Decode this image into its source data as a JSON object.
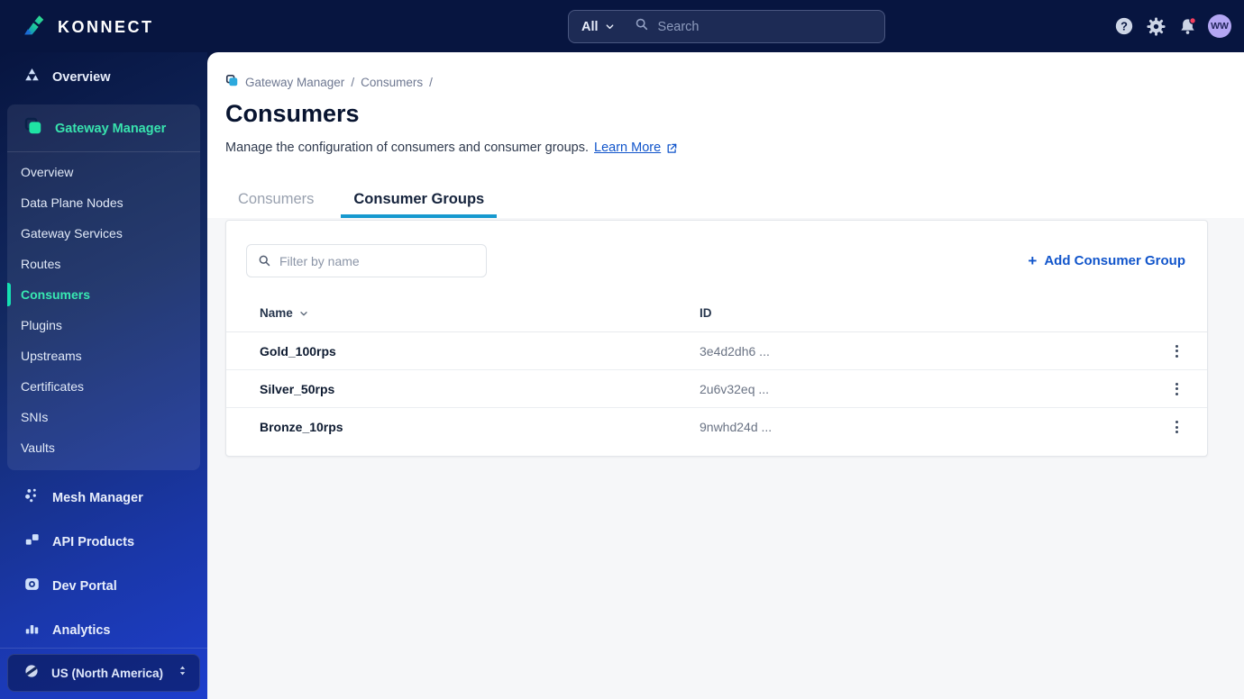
{
  "topbar": {
    "brand": "KONNECT",
    "search_scope": "All",
    "search_placeholder": "Search",
    "avatar_initials": "WW"
  },
  "sidebar": {
    "overview_label": "Overview",
    "gateway_manager": {
      "label": "Gateway Manager",
      "items": [
        "Overview",
        "Data Plane Nodes",
        "Gateway Services",
        "Routes",
        "Consumers",
        "Plugins",
        "Upstreams",
        "Certificates",
        "SNIs",
        "Vaults"
      ],
      "active_item": "Consumers"
    },
    "lower_items": [
      "Mesh Manager",
      "API Products",
      "Dev Portal",
      "Analytics"
    ],
    "region_label": "US (North America)"
  },
  "main": {
    "breadcrumb": {
      "items": [
        "Gateway Manager",
        "Consumers"
      ],
      "separator": "/"
    },
    "title": "Consumers",
    "description": "Manage the configuration of consumers and consumer groups.",
    "learn_more_label": "Learn More",
    "tabs": [
      "Consumers",
      "Consumer Groups"
    ],
    "active_tab": "Consumer Groups",
    "toolbar": {
      "filter_placeholder": "Filter by name",
      "plus_glyph": "+",
      "add_button_label": "Add Consumer Group"
    },
    "table": {
      "columns": [
        "Name",
        "ID"
      ],
      "rows": [
        {
          "name": "Gold_100rps",
          "id": "3e4d2dh6 ..."
        },
        {
          "name": "Silver_50rps",
          "id": "2u6v32eq ..."
        },
        {
          "name": "Bronze_10rps",
          "id": "9nwhd24d ..."
        }
      ]
    }
  },
  "colors": {
    "topbar_bg": "#071540",
    "accent_green": "#1FE3A4",
    "link_blue": "#1155CB",
    "tab_underline": "#1699CF",
    "notification_red": "#F43F5E",
    "avatar_bg": "#B3A6F3"
  }
}
